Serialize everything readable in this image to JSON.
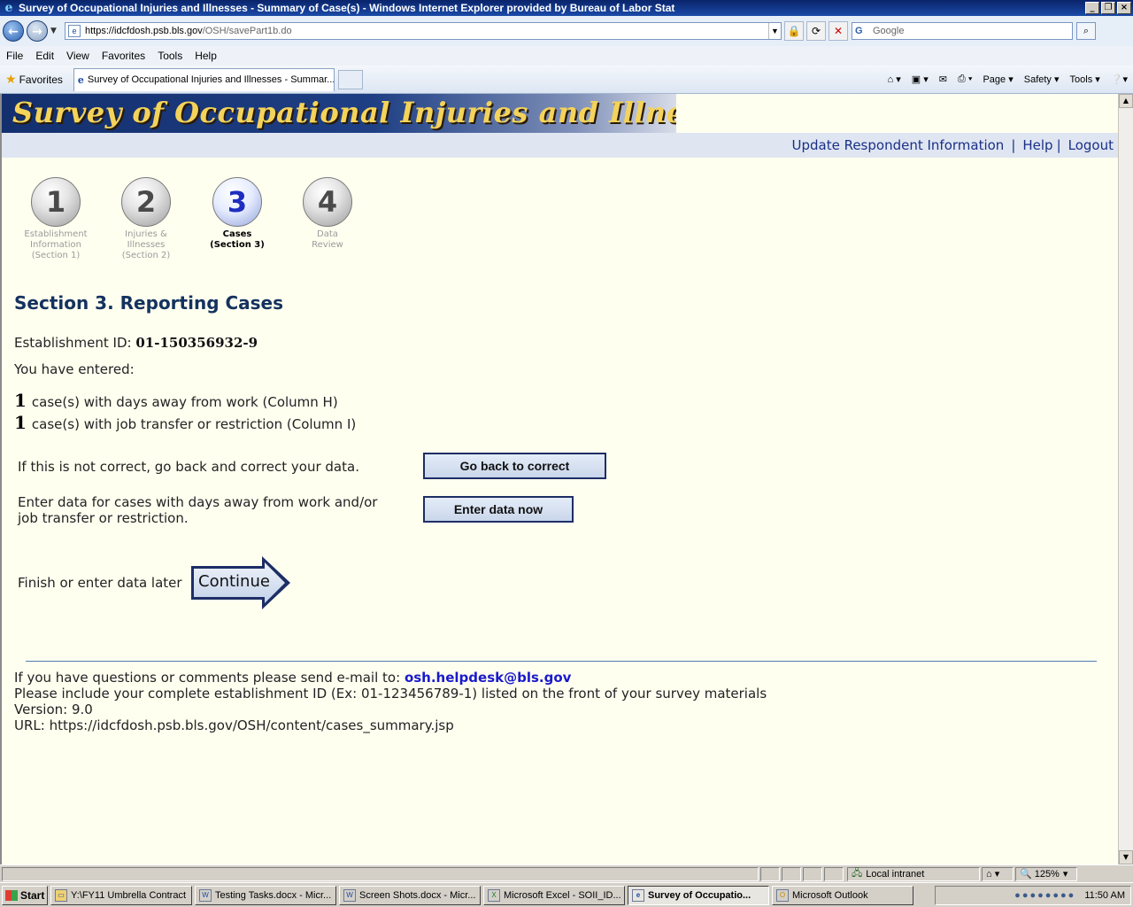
{
  "window": {
    "title": "Survey of Occupational Injuries and Illnesses - Summary of Case(s) - Windows Internet Explorer provided by Bureau of Labor Stat"
  },
  "address_bar": {
    "url_host": "https://idcfdosh.psb.bls.gov",
    "url_path": "/OSH/savePart1b.do",
    "search_placeholder": "Google"
  },
  "menu": [
    "File",
    "Edit",
    "View",
    "Favorites",
    "Tools",
    "Help"
  ],
  "favorites_bar": {
    "favorites_label": "Favorites",
    "tab_title": "Survey of Occupational Injuries and Illnesses - Summar...",
    "commands": [
      "Page ▾",
      "Safety ▾",
      "Tools ▾"
    ]
  },
  "page": {
    "banner_title": "Survey of Occupational Injuries and Illnesses",
    "top_links": {
      "update": "Update Respondent Information",
      "help": "Help",
      "logout": "Logout"
    },
    "steps": [
      {
        "num": "1",
        "label_lines": [
          "Establishment",
          "Information",
          "(Section 1)"
        ],
        "state": "done"
      },
      {
        "num": "2",
        "label_lines": [
          "Injuries &",
          "Illnesses",
          "(Section 2)"
        ],
        "state": "done"
      },
      {
        "num": "3",
        "label_lines": [
          "Cases",
          "(Section 3)"
        ],
        "state": "active"
      },
      {
        "num": "4",
        "label_lines": [
          "Data",
          "Review"
        ],
        "state": "pending"
      }
    ],
    "heading": "Section 3. Reporting Cases",
    "establishment_label": "Establishment ID:",
    "establishment_id": "01-150356932-9",
    "entered_label": "You have entered:",
    "cases": [
      {
        "count": "1",
        "text": "case(s) with days away from work (Column H)"
      },
      {
        "count": "1",
        "text": "case(s) with job transfer or restriction (Column I)"
      }
    ],
    "correct_text": "If this is not correct, go back and correct your data.",
    "go_back_button": "Go back to correct",
    "enter_text_line1": "Enter data for cases with days away from work and/or",
    "enter_text_line2": "job transfer or restriction.",
    "enter_button": "Enter data now",
    "finish_text": "Finish or enter data later",
    "continue_button": "Continue",
    "footer": {
      "question_text": "If you have questions or comments please send e-mail to:",
      "email": "osh.helpdesk@bls.gov",
      "include_text": "Please include your complete establishment ID (Ex: 01-123456789-1) listed on the front of your survey materials",
      "version": "Version: 9.0",
      "url": "URL: https://idcfdosh.psb.bls.gov/OSH/content/cases_summary.jsp"
    }
  },
  "status_bar": {
    "zone": "Local intranet",
    "zoom": "125%"
  },
  "taskbar": {
    "start": "Start",
    "items": [
      {
        "label": "Y:\\FY11 Umbrella Contract",
        "active": false
      },
      {
        "label": "Testing Tasks.docx - Micr...",
        "active": false
      },
      {
        "label": "Screen Shots.docx - Micr...",
        "active": false
      },
      {
        "label": "Microsoft Excel - SOII_ID...",
        "active": false
      },
      {
        "label": "Survey of Occupatio...",
        "active": true
      },
      {
        "label": "Microsoft Outlook",
        "active": false
      }
    ],
    "clock": "11:50 AM"
  }
}
